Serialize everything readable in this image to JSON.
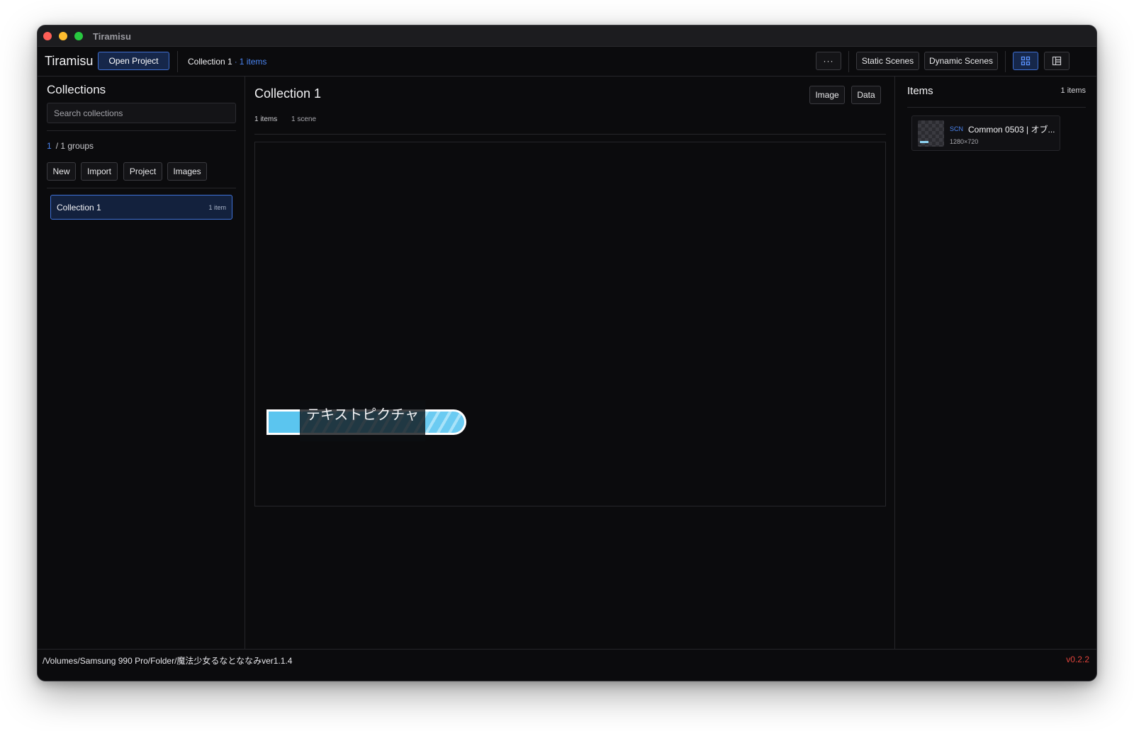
{
  "window": {
    "title": "Tiramisu"
  },
  "toolbar": {
    "app_name": "Tiramisu",
    "open_project_label": "Open Project",
    "breadcrumb_collection": "Collection 1",
    "breadcrumb_separator": "·",
    "breadcrumb_count": "1 items",
    "more_label": "···",
    "static_scenes_label": "Static Scenes",
    "dynamic_scenes_label": "Dynamic Scenes",
    "grid_view_icon": "grid-view-icon",
    "panel_view_icon": "panel-layout-icon"
  },
  "sidebar": {
    "title": "Collections",
    "search_placeholder": "Search collections",
    "groups_current": "1",
    "groups_total": "/ 1 groups",
    "buttons": {
      "new": "New",
      "import": "Import",
      "project": "Project",
      "images": "Images"
    },
    "collections": [
      {
        "name": "Collection 1",
        "count": "1 item",
        "selected": true
      }
    ]
  },
  "main": {
    "title": "Collection 1",
    "image_button": "Image",
    "data_button": "Data",
    "items_count": "1 items",
    "scene_count": "1 scene",
    "preview_text": "テキストピクチャ"
  },
  "right_panel": {
    "title": "Items",
    "count": "1 items",
    "items": [
      {
        "tag": "SCN",
        "name": "Common 0503 | オブ...",
        "dimensions": "1280×720"
      }
    ]
  },
  "statusbar": {
    "path": "/Volumes/Samsung 990 Pro/Folder/魔法少女るなとななみver1.1.4",
    "version": "v0.2.2"
  },
  "colors": {
    "accent": "#4a84f0",
    "background": "#0b0b0d",
    "version_red": "#e0433b",
    "preview_cyan": "#6bcbf2"
  }
}
